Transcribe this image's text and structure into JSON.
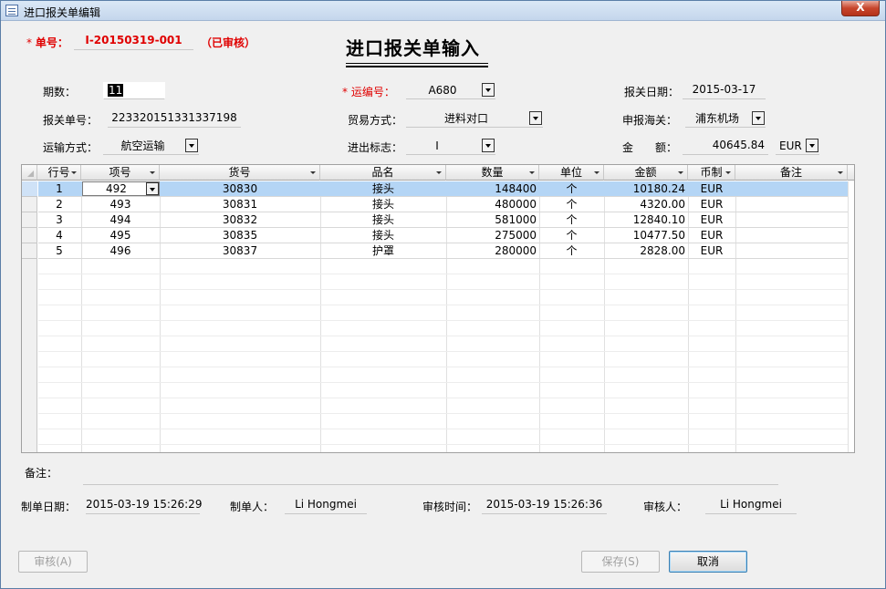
{
  "window": {
    "title": "进口报关单编辑",
    "close_label": "X"
  },
  "heading": "进口报关单输入",
  "form": {
    "doc_no_label": "单号：",
    "doc_no": "I-20150319-001",
    "status": "（已审核）",
    "period_label": "期数：",
    "period": "11",
    "shipping_no_label": "运编号：",
    "shipping_no": "A680",
    "declare_date_label": "报关日期：",
    "declare_date": "2015-03-17",
    "declare_no_label": "报关单号：",
    "declare_no": "223320151331337198",
    "trade_mode_label": "贸易方式：",
    "trade_mode": "进料对口",
    "customs_label": "申报海关：",
    "customs": "浦东机场",
    "transport_label": "运输方式：",
    "transport": "航空运输",
    "io_flag_label": "进出标志：",
    "io_flag": "I",
    "amount_label": "金　　额：",
    "amount": "40645.84",
    "currency": "EUR"
  },
  "table": {
    "headers": [
      "行号",
      "项号",
      "货号",
      "品名",
      "数量",
      "单位",
      "金额",
      "币制",
      "备注"
    ],
    "rows": [
      [
        "1",
        "492",
        "30830",
        "接头",
        "148400",
        "个",
        "10180.24",
        "EUR",
        ""
      ],
      [
        "2",
        "493",
        "30831",
        "接头",
        "480000",
        "个",
        "4320.00",
        "EUR",
        ""
      ],
      [
        "3",
        "494",
        "30832",
        "接头",
        "581000",
        "个",
        "12840.10",
        "EUR",
        ""
      ],
      [
        "4",
        "495",
        "30835",
        "接头",
        "275000",
        "个",
        "10477.50",
        "EUR",
        ""
      ],
      [
        "5",
        "496",
        "30837",
        "护罩",
        "280000",
        "个",
        "2828.00",
        "EUR",
        ""
      ]
    ]
  },
  "footer": {
    "remark_label": "备注：",
    "remark": "",
    "created_date_label": "制单日期：",
    "created_date": "2015-03-19 15:26:29",
    "creator_label": "制单人：",
    "creator": "Li Hongmei",
    "audit_time_label": "审核时间：",
    "audit_time": "2015-03-19 15:26:36",
    "auditor_label": "审核人：",
    "auditor": "Li Hongmei"
  },
  "buttons": {
    "audit": "审核(A)",
    "save": "保存(S)",
    "cancel": "取消"
  }
}
